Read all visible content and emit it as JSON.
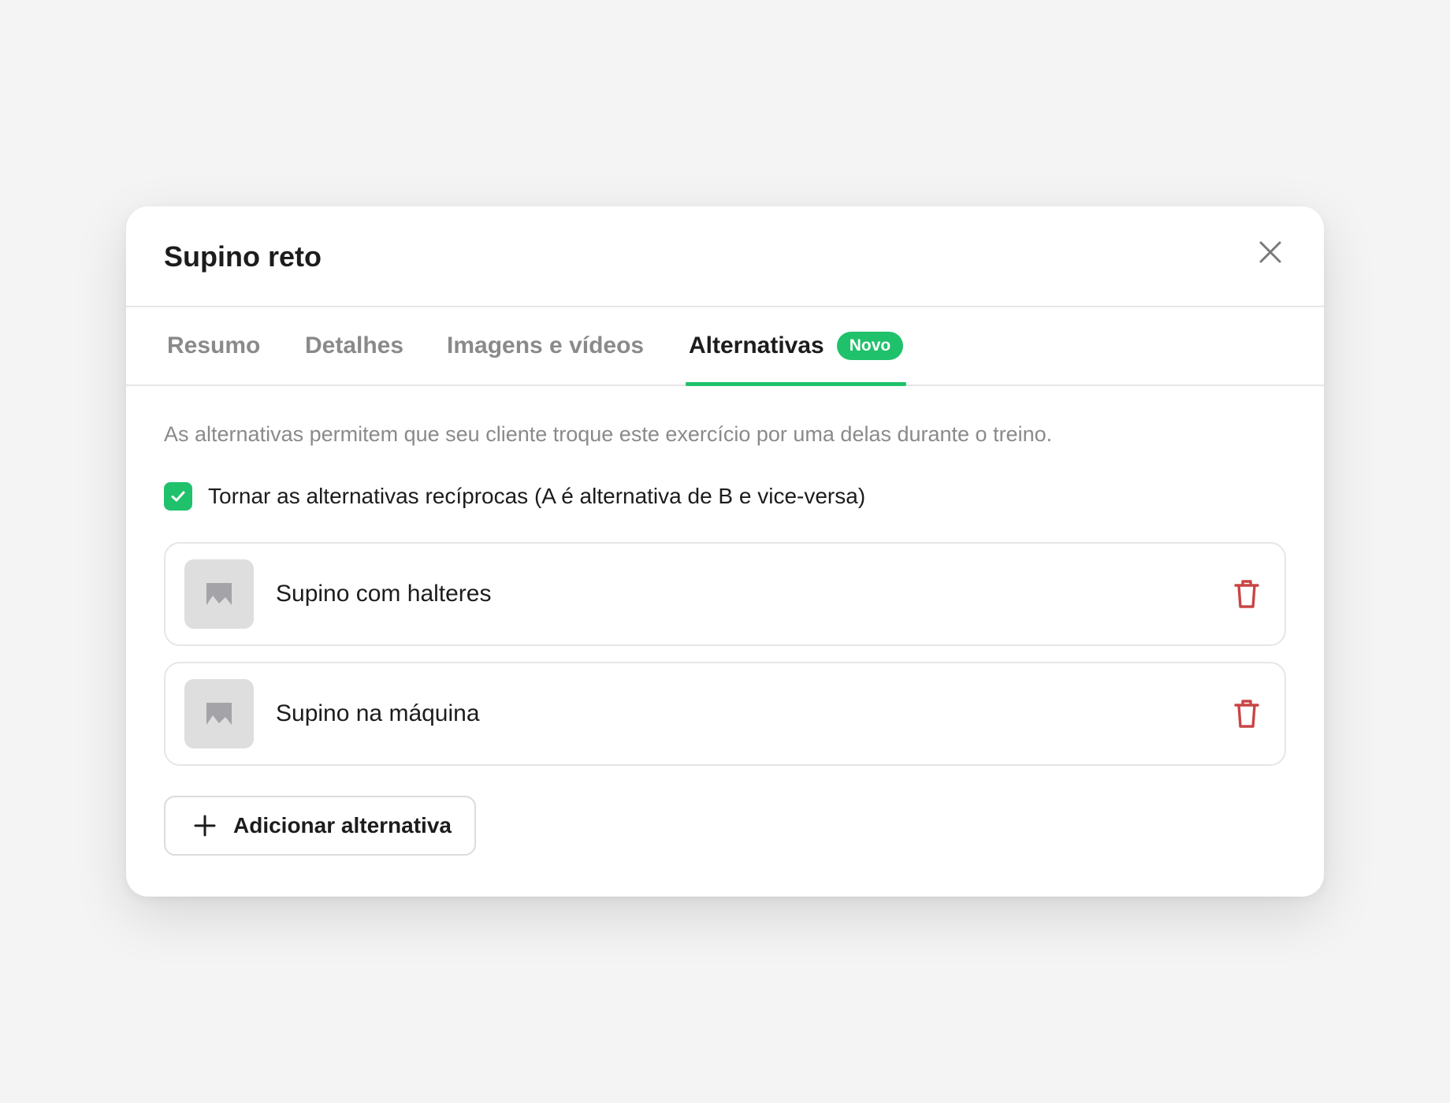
{
  "modal": {
    "title": "Supino reto"
  },
  "tabs": [
    {
      "label": "Resumo",
      "active": false
    },
    {
      "label": "Detalhes",
      "active": false
    },
    {
      "label": "Imagens e vídeos",
      "active": false
    },
    {
      "label": "Alternativas",
      "active": true,
      "badge": "Novo"
    }
  ],
  "alternatives_panel": {
    "description": "As alternativas permitem que seu cliente troque este exercício por uma delas durante o treino.",
    "reciprocal_checkbox": {
      "label": "Tornar as alternativas recíprocas (A é alternativa de B e vice-versa)",
      "checked": true
    },
    "items": [
      {
        "name": "Supino com halteres",
        "thumbnail_icon": "image-placeholder-icon",
        "action_icon": "trash-icon"
      },
      {
        "name": "Supino na máquina",
        "thumbnail_icon": "image-placeholder-icon",
        "action_icon": "trash-icon"
      }
    ],
    "add_button_label": "Adicionar alternativa"
  },
  "colors": {
    "accent": "#1fc16b",
    "danger": "#c94545",
    "muted_text": "#8a8a8a",
    "text": "#1c1c1c"
  }
}
